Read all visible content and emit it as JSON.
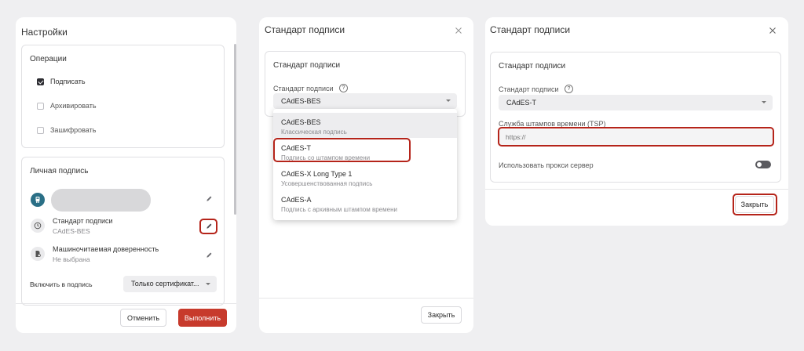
{
  "settings": {
    "title": "Настройки",
    "operations": {
      "title": "Операции",
      "items": [
        {
          "label": "Подписать",
          "checked": true
        },
        {
          "label": "Архивировать",
          "checked": false
        },
        {
          "label": "Зашифровать",
          "checked": false
        }
      ]
    },
    "personal": {
      "title": "Личная подпись",
      "standard_label": "Стандарт подписи",
      "standard_value": "CAdES-BES",
      "proxy_label": "Машиночитаемая доверенность",
      "proxy_value": "Не выбрана",
      "include_label": "Включить в подпись",
      "include_value": "Только сертификат..."
    },
    "cancel_label": "Отменить",
    "execute_label": "Выполнить"
  },
  "standard_dialog": {
    "title": "Стандарт подписи",
    "card_title": "Стандарт подписи",
    "field_label": "Стандарт подписи",
    "selected": "CAdES-BES",
    "options": [
      {
        "title": "CAdES-BES",
        "subtitle": "Классическая подпись"
      },
      {
        "title": "CAdES-T",
        "subtitle": "Подпись со штампом времени"
      },
      {
        "title": "CAdES-X Long Type 1",
        "subtitle": "Усовершенствованная подпись"
      },
      {
        "title": "CAdES-A",
        "subtitle": "Подпись с архивным штампом времени"
      }
    ],
    "close_label": "Закрыть"
  },
  "tsp_dialog": {
    "title": "Стандарт подписи",
    "card_title": "Стандарт подписи",
    "field_label": "Стандарт подписи",
    "selected": "CAdES-T",
    "tsp_label": "Служба штампов времени (TSP)",
    "tsp_placeholder": "https://",
    "proxy_label": "Использовать прокси сервер",
    "proxy_enabled": false,
    "close_label": "Закрыть"
  },
  "colors": {
    "accent_red": "#c73a2c",
    "highlight": "#b5241a",
    "teal": "#2a6f86"
  }
}
